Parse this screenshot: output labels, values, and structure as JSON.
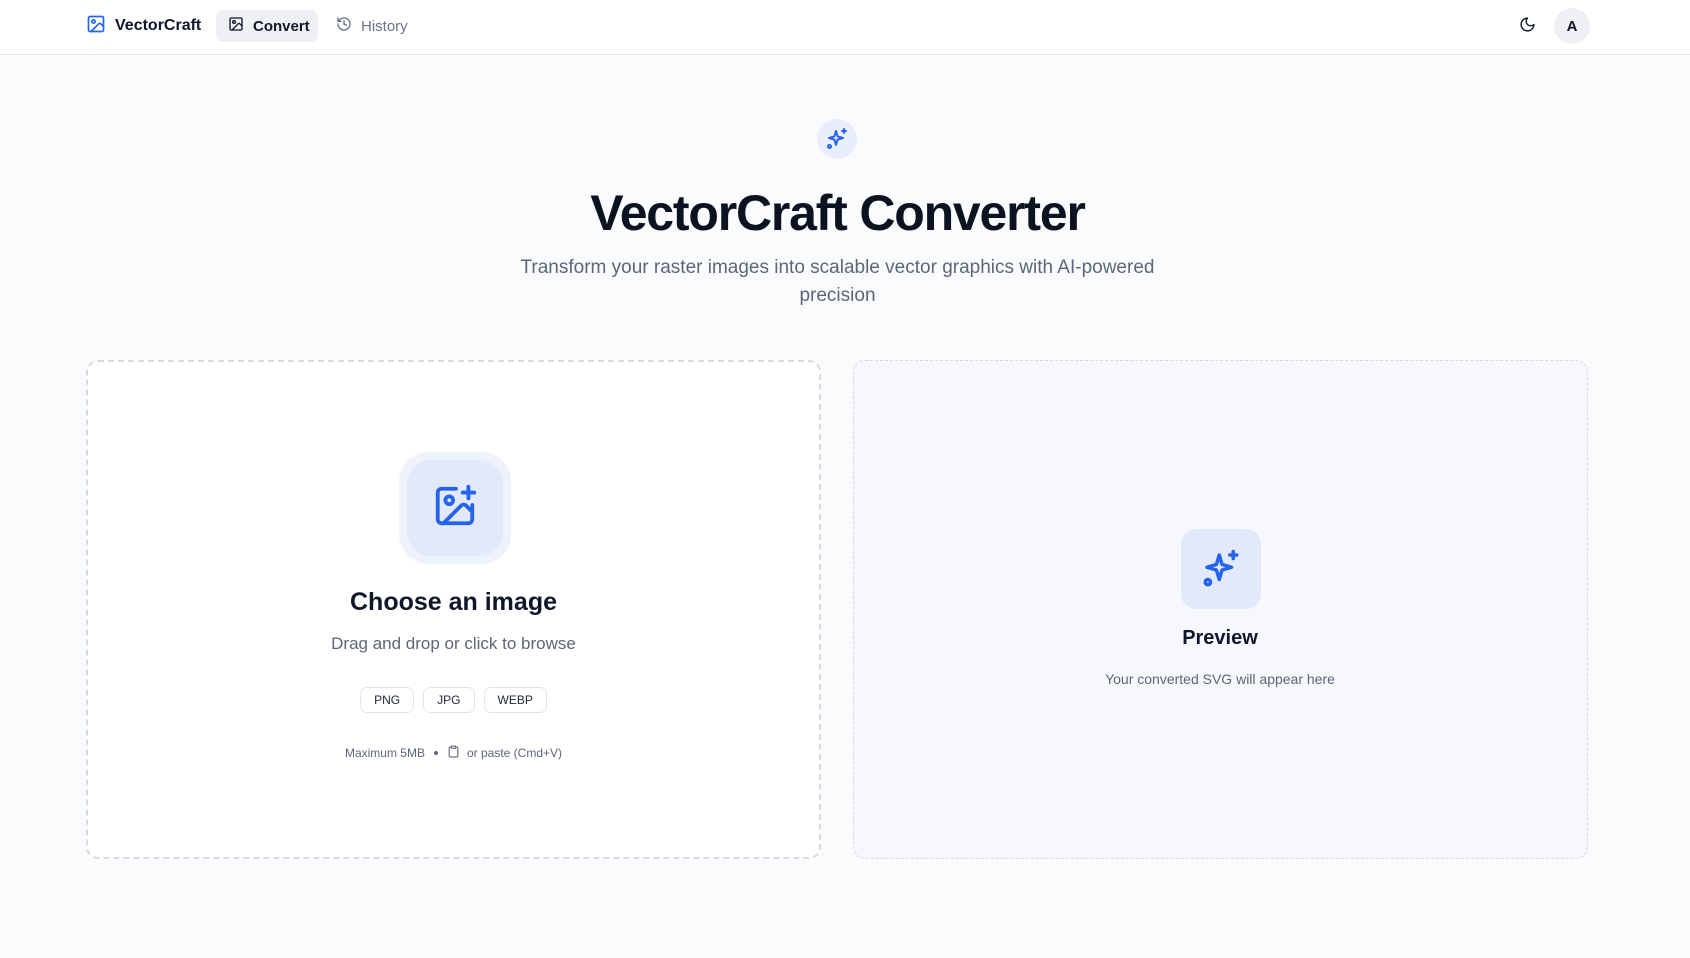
{
  "header": {
    "brand": "VectorCraft",
    "tabs": [
      {
        "label": "Convert",
        "active": true,
        "icon": "image-icon"
      },
      {
        "label": "History",
        "active": false,
        "icon": "history-icon"
      }
    ],
    "theme_icon": "moon-icon",
    "avatar_initial": "A"
  },
  "hero": {
    "icon": "sparkles-icon",
    "title": "VectorCraft Converter",
    "subtitle": "Transform your raster images into scalable vector graphics with AI-powered precision"
  },
  "upload": {
    "icon": "image-plus-icon",
    "title": "Choose an image",
    "subtitle": "Drag and drop or click to browse",
    "formats": [
      "PNG",
      "JPG",
      "WEBP"
    ],
    "max_size": "Maximum 5MB",
    "paste_hint": "or paste (Cmd+V)"
  },
  "preview": {
    "icon": "sparkles-icon",
    "title": "Preview",
    "subtitle": "Your converted SVG will appear here"
  },
  "colors": {
    "accent": "#2563eb",
    "accent_bg": "#e1e9fb",
    "text_muted": "#5b6779"
  }
}
